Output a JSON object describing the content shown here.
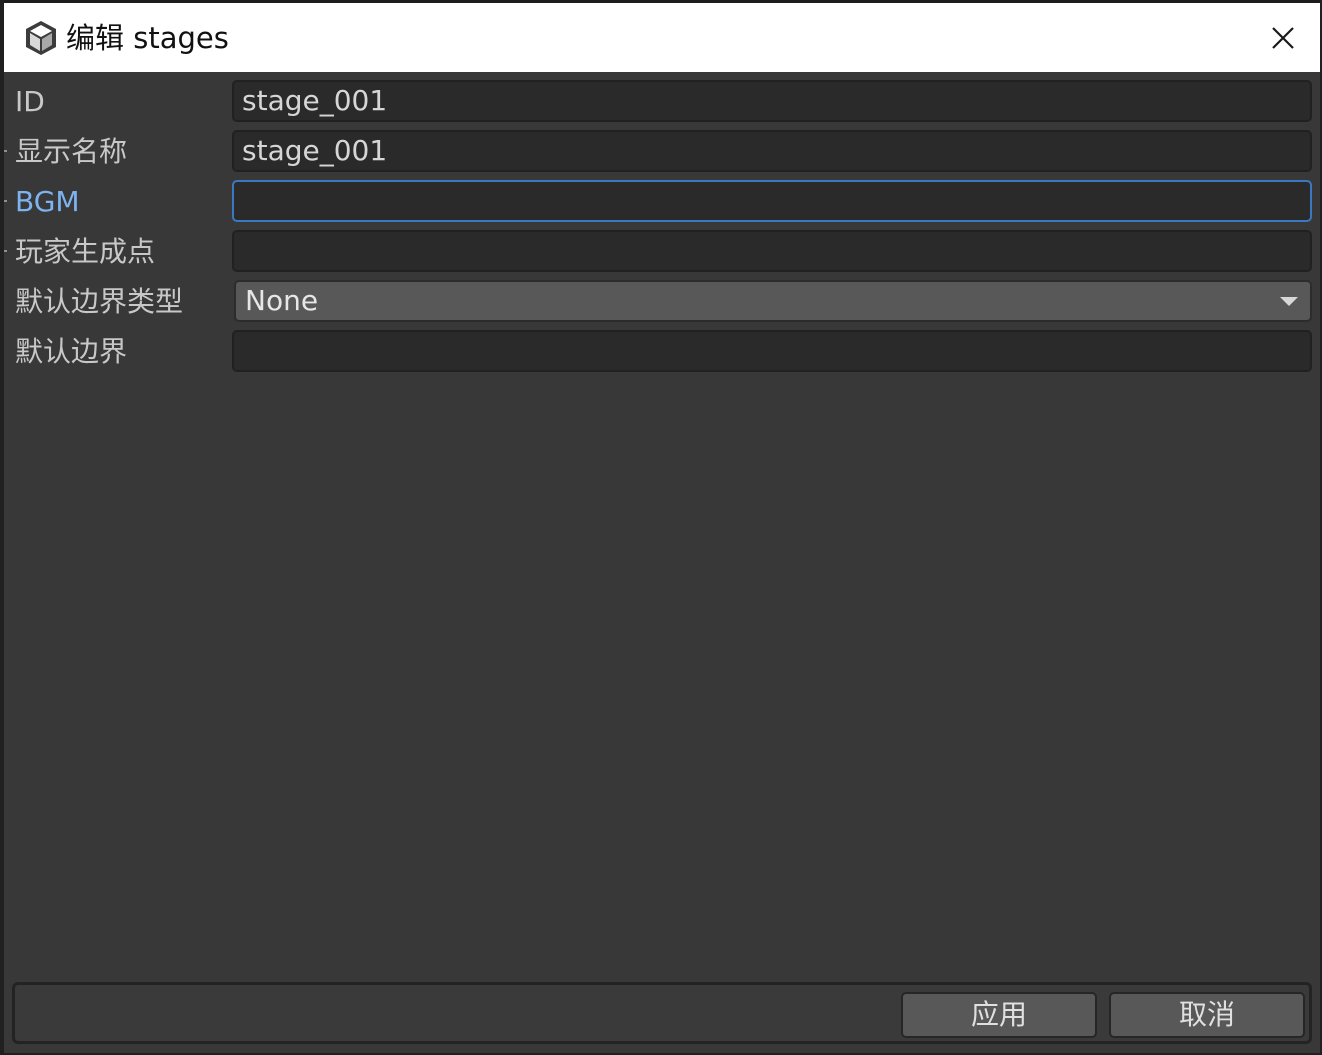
{
  "window": {
    "title": "编辑 stages",
    "icon": "unity-cube-icon"
  },
  "form": {
    "fields": [
      {
        "label": "ID",
        "value": "stage_001",
        "type": "text"
      },
      {
        "label": "显示名称",
        "value": "stage_001",
        "type": "text"
      },
      {
        "label": "BGM",
        "value": "",
        "type": "text",
        "focused": true
      },
      {
        "label": "玩家生成点",
        "value": "",
        "type": "text"
      },
      {
        "label": "默认边界类型",
        "value": "None",
        "type": "dropdown"
      },
      {
        "label": "默认边界",
        "value": "",
        "type": "text"
      }
    ]
  },
  "footer": {
    "apply_label": "应用",
    "cancel_label": "取消"
  },
  "colors": {
    "focus_accent": "#3a79c2",
    "focused_label": "#7db3f0",
    "background": "#383838",
    "field_background": "#2a2a2a"
  }
}
